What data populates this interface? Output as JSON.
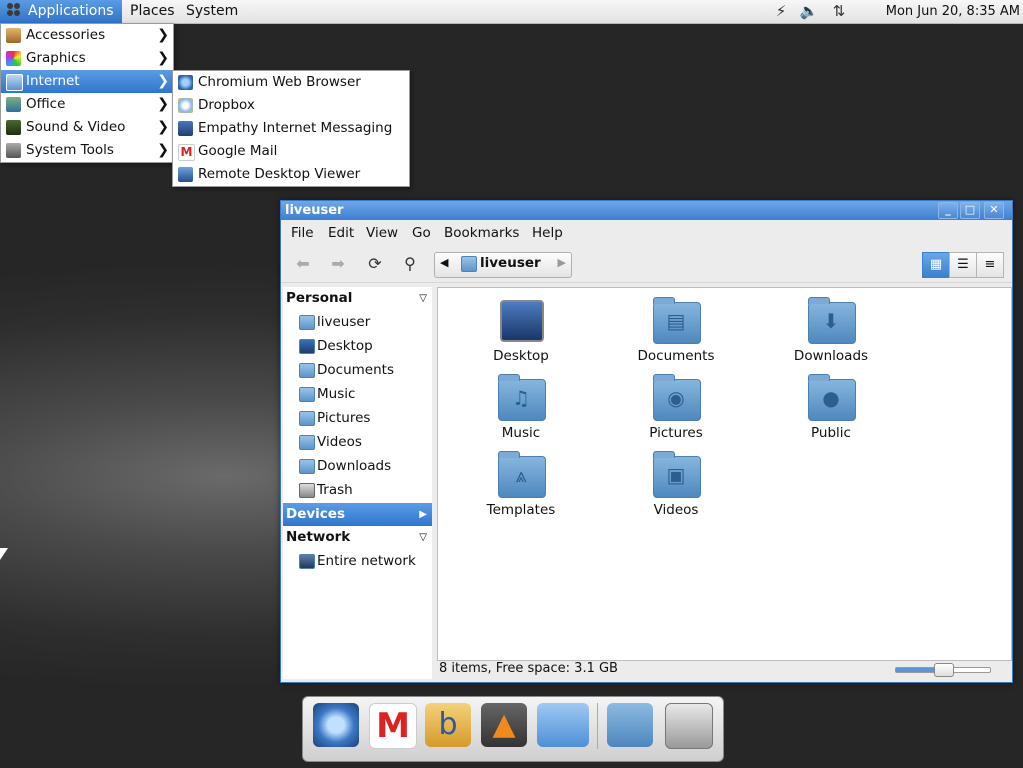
{
  "panel": {
    "menus": [
      "Applications",
      "Places",
      "System"
    ],
    "clock": "Mon Jun 20,  8:35 AM",
    "tray_icons": [
      "power-icon",
      "volume-icon",
      "network-icon"
    ]
  },
  "app_menu": {
    "items": [
      {
        "label": "Accessories",
        "icon": "accessories-icon"
      },
      {
        "label": "Graphics",
        "icon": "graphics-icon"
      },
      {
        "label": "Internet",
        "icon": "internet-icon"
      },
      {
        "label": "Office",
        "icon": "office-icon"
      },
      {
        "label": "Sound & Video",
        "icon": "sound-video-icon"
      },
      {
        "label": "System Tools",
        "icon": "system-tools-icon"
      }
    ],
    "highlighted": "Internet"
  },
  "internet_menu": {
    "items": [
      {
        "label": "Chromium Web Browser",
        "icon": "chromium-icon"
      },
      {
        "label": "Dropbox",
        "icon": "dropbox-icon"
      },
      {
        "label": "Empathy Internet Messaging",
        "icon": "empathy-icon"
      },
      {
        "label": "Google Mail",
        "icon": "gmail-icon"
      },
      {
        "label": "Remote Desktop Viewer",
        "icon": "remote-desktop-icon"
      }
    ]
  },
  "window": {
    "title": "liveuser",
    "controls": [
      "_",
      "□",
      "✕"
    ],
    "menubar": [
      "File",
      "Edit",
      "View",
      "Go",
      "Bookmarks",
      "Help"
    ],
    "breadcrumb": "liveuser",
    "sidebar": {
      "personal_label": "Personal",
      "personal_items": [
        "liveuser",
        "Desktop",
        "Documents",
        "Music",
        "Pictures",
        "Videos",
        "Downloads",
        "Trash"
      ],
      "devices_label": "Devices",
      "network_label": "Network",
      "network_items": [
        "Entire network"
      ]
    },
    "files": [
      {
        "name": "Desktop",
        "icon": "desktop-icon"
      },
      {
        "name": "Documents",
        "icon": "documents-folder-icon"
      },
      {
        "name": "Downloads",
        "icon": "downloads-folder-icon"
      },
      {
        "name": "Music",
        "icon": "music-folder-icon"
      },
      {
        "name": "Pictures",
        "icon": "pictures-folder-icon"
      },
      {
        "name": "Public",
        "icon": "public-folder-icon"
      },
      {
        "name": "Templates",
        "icon": "templates-folder-icon"
      },
      {
        "name": "Videos",
        "icon": "videos-folder-icon"
      }
    ],
    "status": "8 items, Free space: 3.1 GB",
    "zoom_level": 0.5
  },
  "dock": {
    "items": [
      "chromium-icon",
      "gmail-icon",
      "bubble-icon",
      "vlc-icon",
      "workspace-icon",
      "folder-icon",
      "trash-icon"
    ]
  }
}
